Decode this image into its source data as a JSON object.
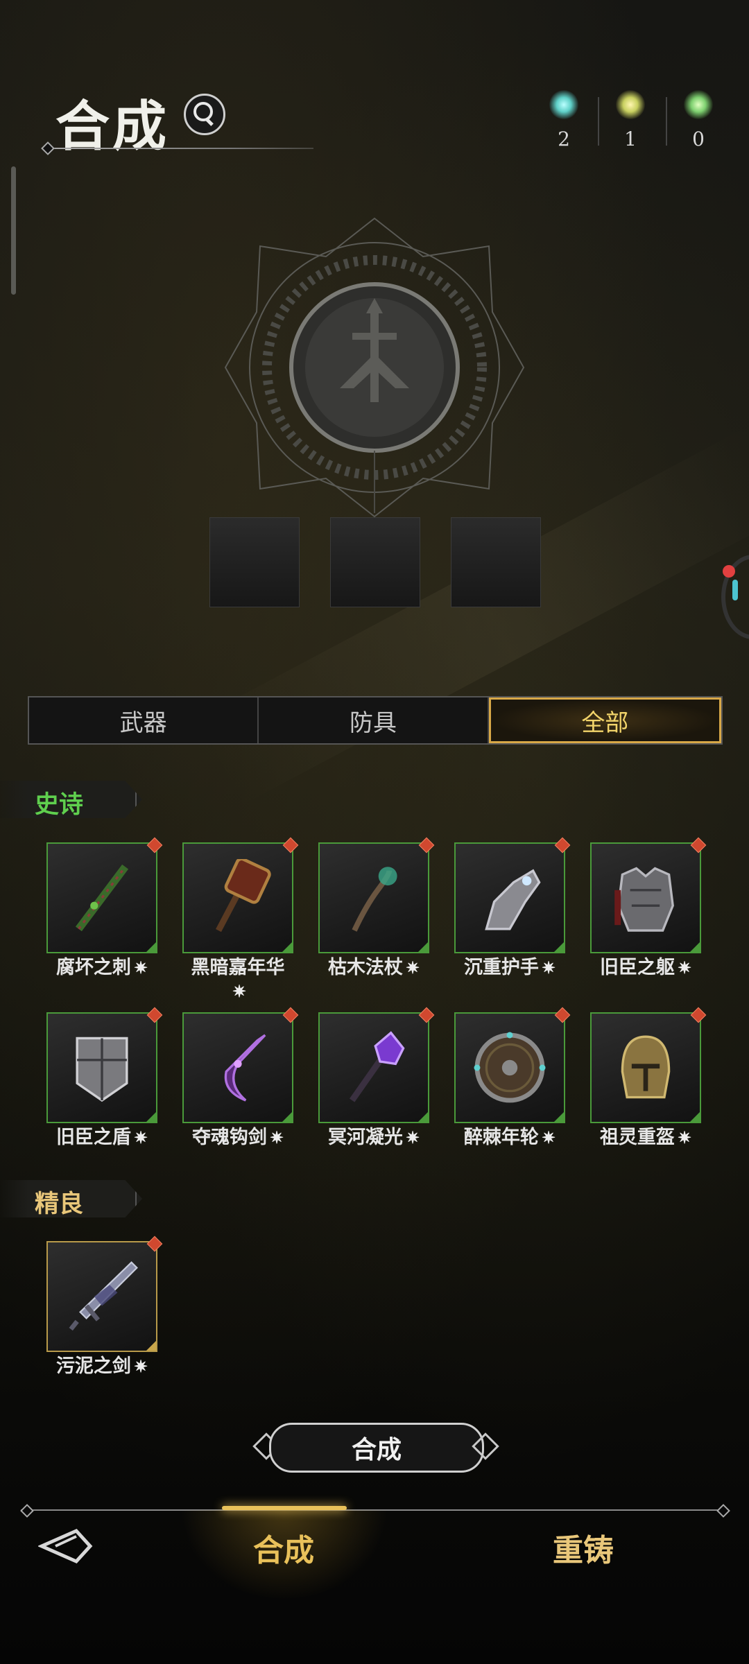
{
  "header": {
    "title": "合成"
  },
  "currencies": [
    {
      "icon": "cyan-spiral-gem-icon",
      "value": "2",
      "color": "#5fd0c8"
    },
    {
      "icon": "yellow-green-spiral-gem-icon",
      "value": "1",
      "color": "#c8d060"
    },
    {
      "icon": "green-spiral-gem-icon",
      "value": "0",
      "color": "#7ed070"
    }
  ],
  "tabs": [
    {
      "label": "武器",
      "active": false
    },
    {
      "label": "防具",
      "active": false
    },
    {
      "label": "全部",
      "active": true
    }
  ],
  "sections": {
    "epic": {
      "label": "史诗",
      "color": "#5fcf4e",
      "items": [
        {
          "name": "腐坏之刺",
          "icon": "thorn-dagger-icon"
        },
        {
          "name": "黑暗嘉年华",
          "icon": "war-hammer-icon"
        },
        {
          "name": "枯木法杖",
          "icon": "withered-staff-icon"
        },
        {
          "name": "沉重护手",
          "icon": "gauntlet-icon"
        },
        {
          "name": "旧臣之躯",
          "icon": "plate-armor-icon"
        },
        {
          "name": "旧臣之盾",
          "icon": "tower-shield-icon"
        },
        {
          "name": "夺魂钩剑",
          "icon": "hook-sword-icon"
        },
        {
          "name": "冥河凝光",
          "icon": "purple-mace-icon"
        },
        {
          "name": "醉棘年轮",
          "icon": "round-shield-icon"
        },
        {
          "name": "祖灵重盔",
          "icon": "gold-helmet-icon"
        }
      ]
    },
    "fine": {
      "label": "精良",
      "color": "#e9c77a",
      "items": [
        {
          "name": "污泥之剑",
          "icon": "mud-sword-icon"
        }
      ]
    }
  },
  "craft_button": "合成",
  "bottom_nav": [
    {
      "label": "合成",
      "active": true,
      "color": "#e9c15a"
    },
    {
      "label": "重铸",
      "active": false,
      "color": "#e9c77a"
    }
  ],
  "spark_glyph": "✷"
}
